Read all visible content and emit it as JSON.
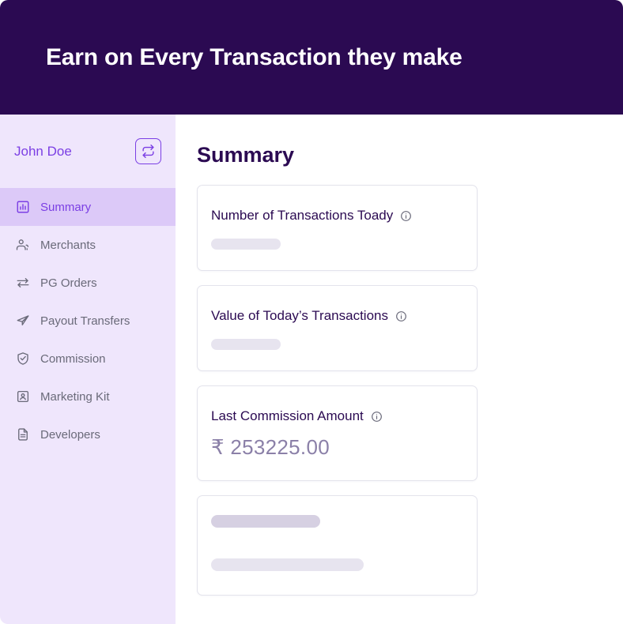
{
  "banner": {
    "title": "Earn on Every Transaction they make",
    "background_color": "#2B0A52"
  },
  "sidebar": {
    "user_name": "John Doe",
    "switch_button_label": "",
    "switch_icon": "swap-arrows-icon",
    "accent_color": "#7B3FE4",
    "background_color": "#EFE6FC",
    "active_background_color": "#DCC9F8",
    "items": [
      {
        "label": "Summary",
        "icon": "bar-chart-icon",
        "active": true
      },
      {
        "label": "Merchants",
        "icon": "users-icon",
        "active": false
      },
      {
        "label": "PG Orders",
        "icon": "swap-arrows-icon",
        "active": false
      },
      {
        "label": "Payout Transfers",
        "icon": "send-icon",
        "active": false
      },
      {
        "label": "Commission",
        "icon": "shield-check-icon",
        "active": false
      },
      {
        "label": "Marketing Kit",
        "icon": "id-card-icon",
        "active": false
      },
      {
        "label": "Developers",
        "icon": "document-icon",
        "active": false
      }
    ]
  },
  "main": {
    "page_title": "Summary",
    "cards": [
      {
        "title": "Number of Transactions Toady",
        "info_icon": "info-icon",
        "state": "loading",
        "value": ""
      },
      {
        "title": "Value of Today’s Transactions",
        "info_icon": "info-icon",
        "state": "loading",
        "value": ""
      },
      {
        "title": "Last Commission Amount",
        "info_icon": "info-icon",
        "state": "loaded",
        "value": "₹ 253225.00"
      }
    ],
    "placeholder_card": {
      "state": "loading",
      "rows": 2
    }
  }
}
